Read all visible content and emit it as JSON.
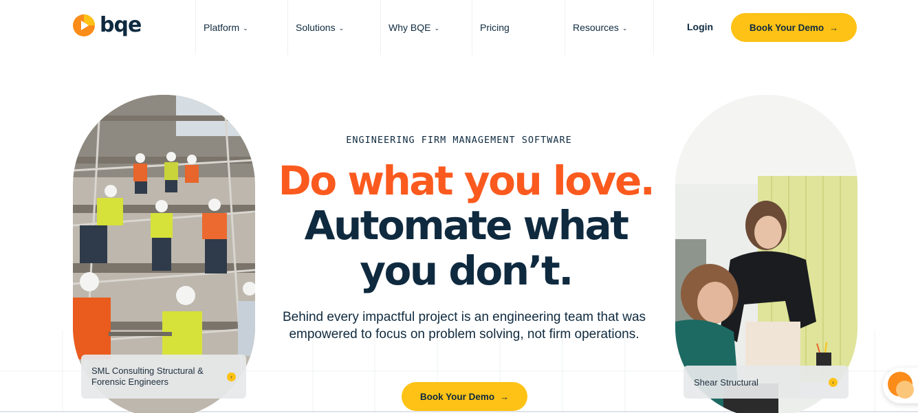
{
  "header": {
    "logo_text": "bqe",
    "nav": [
      {
        "label": "Platform",
        "has_menu": true
      },
      {
        "label": "Solutions",
        "has_menu": true
      },
      {
        "label": "Why BQE",
        "has_menu": true
      },
      {
        "label": "Pricing",
        "has_menu": false
      },
      {
        "label": "Resources",
        "has_menu": true
      }
    ],
    "chevron": "⌄",
    "login_label": "Login",
    "demo_label": "Book Your Demo",
    "arrow": "→"
  },
  "hero": {
    "eyebrow": "ENGINEERING FIRM MANAGEMENT SOFTWARE",
    "headline_orange": "Do what you love.",
    "headline_line2": "Automate what",
    "headline_line3": "you don’t.",
    "lead": "Behind every impactful project is an engineering team that was empowered to focus on problem solving, not firm operations.",
    "cta_label": "Book Your Demo",
    "cta_arrow": "→"
  },
  "photos": {
    "left_caption": "SML Consulting Structural & Forensic Engineers",
    "right_caption": "Shear Structural",
    "caption_icon": "›"
  },
  "colors": {
    "brand_orange": "#fb5a1f",
    "brand_yellow": "#fdc215",
    "navy": "#0f2a3f"
  },
  "icons": {
    "logo": "play-logo-icon",
    "chevron": "chevron-down-icon",
    "arrow": "arrow-right-icon",
    "chat": "chat-bubble-icon"
  }
}
